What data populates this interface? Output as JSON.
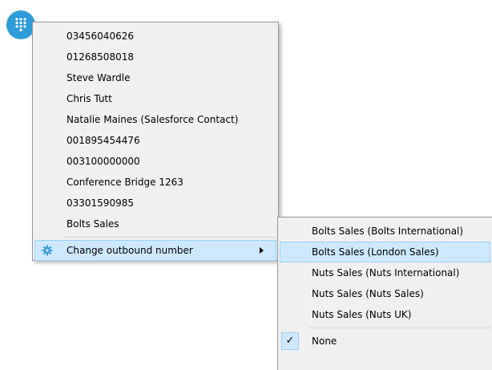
{
  "main_menu": {
    "items": [
      {
        "label": "03456040626"
      },
      {
        "label": "01268508018"
      },
      {
        "label": "Steve Wardle"
      },
      {
        "label": "Chris Tutt"
      },
      {
        "label": "Natalie Maines (Salesforce Contact)"
      },
      {
        "label": "001895454476"
      },
      {
        "label": "003100000000"
      },
      {
        "label": " Conference Bridge 1263"
      },
      {
        "label": "03301590985"
      },
      {
        "label": " Bolts Sales"
      }
    ],
    "change_outbound": {
      "label": "Change outbound number",
      "icon": "gear-icon",
      "has_submenu": true
    }
  },
  "sub_menu": {
    "items": [
      {
        "label": "Bolts Sales (Bolts International)"
      },
      {
        "label": "Bolts Sales (London Sales)",
        "highlighted": true
      },
      {
        "label": "Nuts Sales (Nuts International)"
      },
      {
        "label": "Nuts Sales (Nuts Sales)"
      },
      {
        "label": "Nuts Sales (Nuts UK)"
      }
    ],
    "none": {
      "label": "None",
      "checked": true,
      "check_mark": "✓"
    }
  },
  "colors": {
    "dialpad_bg": "#2f9bd8",
    "highlight": "#cde8ff",
    "highlight_border": "#99d1ff",
    "menu_bg": "#f0f0f0"
  }
}
